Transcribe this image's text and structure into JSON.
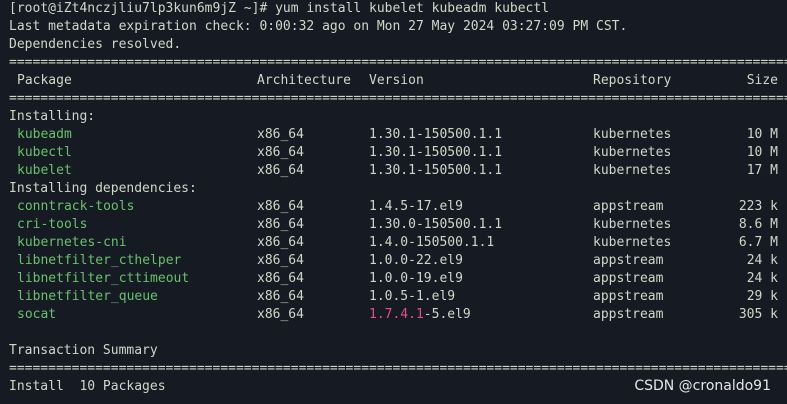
{
  "terminal": {
    "prompt": "[root@iZt4nczjliu7lp3kun6m9jZ ~]# yum install kubelet kubeadm kubectl",
    "metadata": "Last metadata expiration check: 0:00:32 ago on Mon 27 May 2024 03:27:09 PM CST.",
    "deps_resolved": "Dependencies resolved.",
    "separator": "==========================================================================================================================================",
    "columns": {
      "package": "Package",
      "architecture": "Architecture",
      "version": "Version",
      "repository": "Repository",
      "size": "Size"
    },
    "installing_label": "Installing:",
    "installing": [
      {
        "name": "kubeadm",
        "arch": "x86_64",
        "version": "1.30.1-150500.1.1",
        "repo": "kubernetes",
        "size": "10 M"
      },
      {
        "name": "kubectl",
        "arch": "x86_64",
        "version": "1.30.1-150500.1.1",
        "repo": "kubernetes",
        "size": "10 M"
      },
      {
        "name": "kubelet",
        "arch": "x86_64",
        "version": "1.30.1-150500.1.1",
        "repo": "kubernetes",
        "size": "17 M"
      }
    ],
    "deps_label": "Installing dependencies:",
    "deps": [
      {
        "name": "conntrack-tools",
        "arch": "x86_64",
        "version": "1.4.5-17.el9",
        "repo": "appstream",
        "size": "223 k"
      },
      {
        "name": "cri-tools",
        "arch": "x86_64",
        "version": "1.30.0-150500.1.1",
        "repo": "kubernetes",
        "size": "8.6 M"
      },
      {
        "name": "kubernetes-cni",
        "arch": "x86_64",
        "version": "1.4.0-150500.1.1",
        "repo": "kubernetes",
        "size": "6.7 M"
      },
      {
        "name": "libnetfilter_cthelper",
        "arch": "x86_64",
        "version": "1.0.0-22.el9",
        "repo": "appstream",
        "size": "24 k"
      },
      {
        "name": "libnetfilter_cttimeout",
        "arch": "x86_64",
        "version": "1.0.0-19.el9",
        "repo": "appstream",
        "size": "24 k"
      },
      {
        "name": "libnetfilter_queue",
        "arch": "x86_64",
        "version": "1.0.5-1.el9",
        "repo": "appstream",
        "size": "29 k"
      },
      {
        "name": "socat",
        "arch": "x86_64",
        "version_highlight": "1.7.4.1",
        "version_rest": "-5.el9",
        "repo": "appstream",
        "size": "305 k"
      }
    ],
    "summary_label": "Transaction Summary",
    "install_summary": "Install  10 Packages"
  },
  "watermark": "CSDN @cronaldo91",
  "colors": {
    "background": "#161a22",
    "text": "#cfd8c8",
    "package_green": "#67c26b",
    "highlight_pink": "#e0508f"
  }
}
